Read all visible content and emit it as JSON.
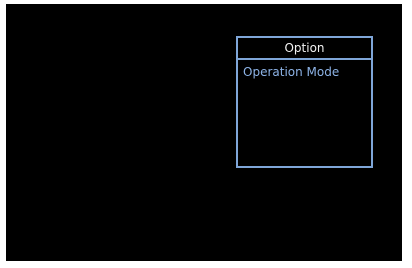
{
  "option_menu": {
    "title": "Option",
    "items": [
      {
        "label": "Operation Mode"
      }
    ]
  },
  "colors": {
    "screen_background": "#000000",
    "panel_border": "#7fa6d8",
    "title_text": "#f2f2f2",
    "item_text": "#8db3e6"
  }
}
